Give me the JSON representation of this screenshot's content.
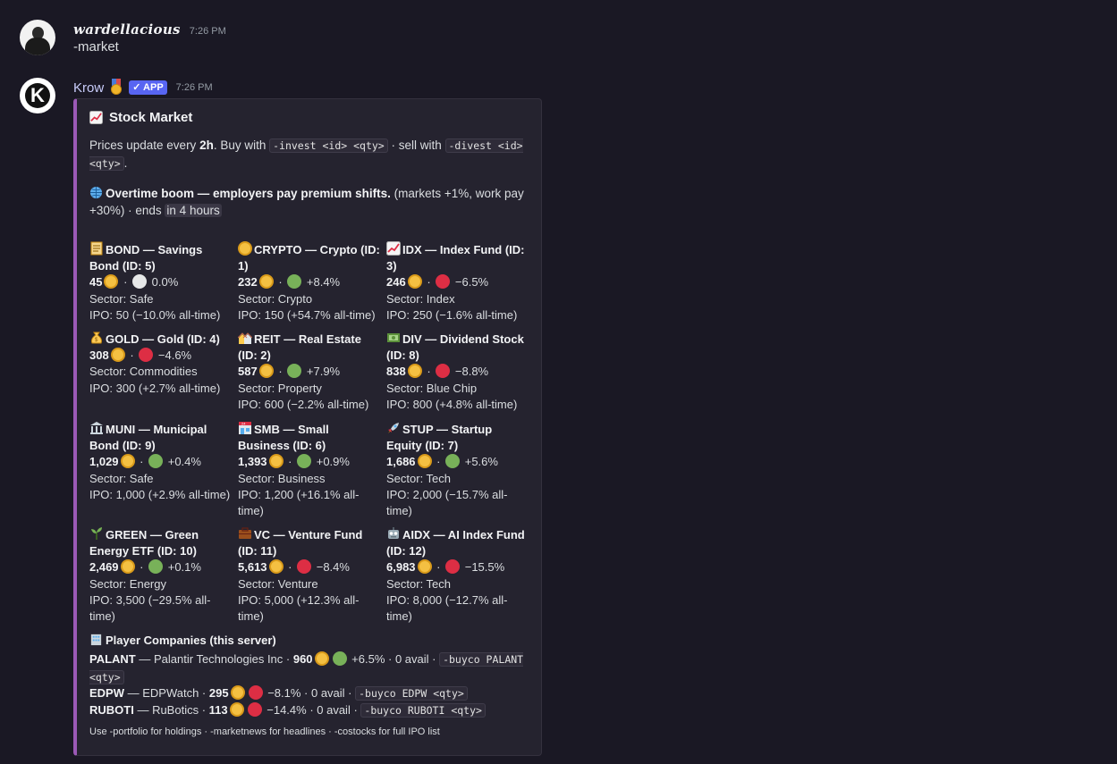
{
  "messages": {
    "user": {
      "name": "wardellacious",
      "time": "7:26 PM",
      "text": "-market"
    },
    "bot": {
      "name": "Krow",
      "tag": "✓ APP",
      "time": "7:26 PM",
      "avatar_letter": "K"
    }
  },
  "embed": {
    "title": "Stock Market",
    "title_icon": "chart-increasing-icon",
    "desc_pre": "Prices update every ",
    "desc_interval": "2h",
    "desc_mid": ". Buy with ",
    "invest_cmd": "-invest <id> <qty>",
    "desc_mid2": " · sell with ",
    "divest_cmd": "-divest <id> <qty>",
    "desc_end": ".",
    "event_icon": "globe-icon",
    "event_bold": "Overtime boom — employers pay premium shifts.",
    "event_rest": " (markets +1%, work pay +30%) · ends ",
    "event_ends": "in 4 hours",
    "accent_color": "#9b59b6",
    "stocks": [
      {
        "icon": "scroll-icon",
        "name": "BOND — Savings Bond (ID: 5)",
        "price": "45",
        "trend": "white",
        "change": "0.0%",
        "sector": "Sector: Safe",
        "ipo": "IPO: 50 (−10.0% all-time)"
      },
      {
        "icon": "coin-icon",
        "name": "CRYPTO — Crypto (ID: 1)",
        "price": "232",
        "trend": "green",
        "change": "+8.4%",
        "sector": "Sector: Crypto",
        "ipo": "IPO: 150 (+54.7% all-time)"
      },
      {
        "icon": "chart-increasing-icon",
        "name": "IDX — Index Fund (ID: 3)",
        "price": "246",
        "trend": "red",
        "change": "−6.5%",
        "sector": "Sector: Index",
        "ipo": "IPO: 250 (−1.6% all-time)"
      },
      {
        "icon": "money-bag-icon",
        "name": "GOLD — Gold (ID: 4)",
        "price": "308",
        "trend": "red",
        "change": "−4.6%",
        "sector": "Sector: Commodities",
        "ipo": "IPO: 300 (+2.7% all-time)"
      },
      {
        "icon": "houses-icon",
        "name": "REIT — Real Estate (ID: 2)",
        "price": "587",
        "trend": "green",
        "change": "+7.9%",
        "sector": "Sector: Property",
        "ipo": "IPO: 600 (−2.2% all-time)"
      },
      {
        "icon": "dollar-banknote-icon",
        "name": "DIV — Dividend Stock (ID: 8)",
        "price": "838",
        "trend": "red",
        "change": "−8.8%",
        "sector": "Sector: Blue Chip",
        "ipo": "IPO: 800 (+4.8% all-time)"
      },
      {
        "icon": "classical-building-icon",
        "name": "MUNI — Municipal Bond (ID: 9)",
        "price": "1,029",
        "trend": "green",
        "change": "+0.4%",
        "sector": "Sector: Safe",
        "ipo": "IPO: 1,000 (+2.9% all-time)"
      },
      {
        "icon": "convenience-store-icon",
        "name": "SMB — Small Business (ID: 6)",
        "price": "1,393",
        "trend": "green",
        "change": "+0.9%",
        "sector": "Sector: Business",
        "ipo": "IPO: 1,200 (+16.1% all-time)"
      },
      {
        "icon": "rocket-icon",
        "name": "STUP — Startup Equity (ID: 7)",
        "price": "1,686",
        "trend": "green",
        "change": "+5.6%",
        "sector": "Sector: Tech",
        "ipo": "IPO: 2,000 (−15.7% all-time)"
      },
      {
        "icon": "seedling-icon",
        "name": "GREEN — Green Energy ETF (ID: 10)",
        "price": "2,469",
        "trend": "green",
        "change": "+0.1%",
        "sector": "Sector: Energy",
        "ipo": "IPO: 3,500 (−29.5% all-time)"
      },
      {
        "icon": "briefcase-icon",
        "name": "VC — Venture Fund (ID: 11)",
        "price": "5,613",
        "trend": "red",
        "change": "−8.4%",
        "sector": "Sector: Venture",
        "ipo": "IPO: 5,000 (+12.3% all-time)"
      },
      {
        "icon": "robot-icon",
        "name": "AIDX — AI Index Fund (ID: 12)",
        "price": "6,983",
        "trend": "red",
        "change": "−15.5%",
        "sector": "Sector: Tech",
        "ipo": "IPO: 8,000 (−12.7% all-time)"
      }
    ],
    "player_companies": {
      "icon": "office-building-icon",
      "title": "Player Companies (this server)",
      "rows": [
        {
          "ticker": "PALANT",
          "desc": " — Palantir Technologies Inc · ",
          "price": "960",
          "trend": "green",
          "change": "+6.5% · 0 avail · ",
          "cmd": "-buyco PALANT <qty>"
        },
        {
          "ticker": "EDPW",
          "desc": " — EDPWatch · ",
          "price": "295",
          "trend": "red",
          "change": "−8.1% · 0 avail · ",
          "cmd": "-buyco EDPW <qty>"
        },
        {
          "ticker": "RUBOTI",
          "desc": " — RuBotics · ",
          "price": "113",
          "trend": "red",
          "change": "−14.4% · 0 avail · ",
          "cmd": "-buyco RUBOTI <qty>"
        }
      ]
    },
    "footer": "Use -portfolio for holdings · -marketnews for headlines · -costocks for full IPO list"
  }
}
